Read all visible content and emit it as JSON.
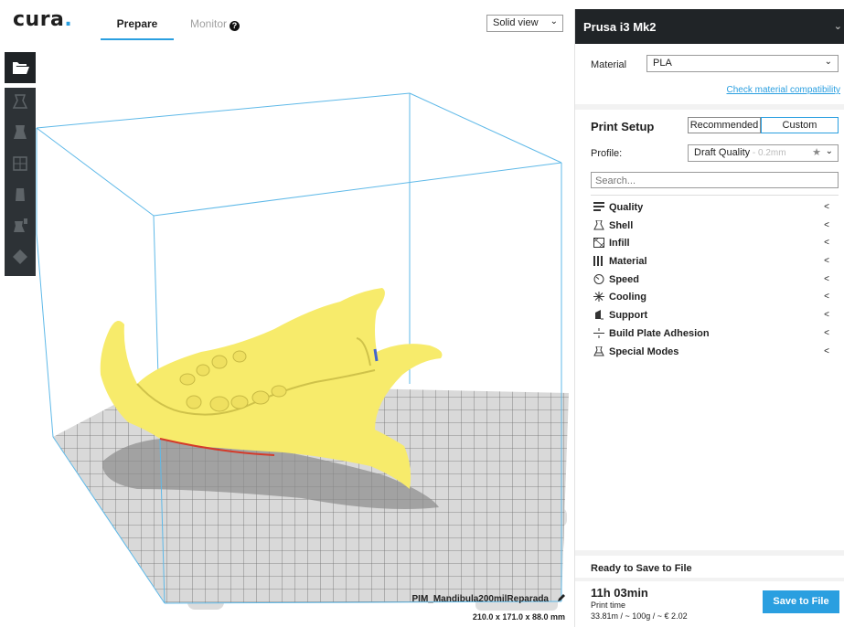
{
  "header": {
    "logo_text": "cura",
    "logo_dot": ".",
    "tabs": [
      {
        "label": "Prepare",
        "active": true
      },
      {
        "label": "Monitor",
        "active": false
      }
    ],
    "view_mode": "Solid view"
  },
  "toolbar": {
    "icons": [
      "open-file-icon",
      "move-tool-icon",
      "scale-tool-icon",
      "rotate-tool-icon",
      "mirror-tool-icon",
      "per-model-settings-icon",
      "support-blocker-icon"
    ]
  },
  "panel": {
    "machine_name": "Prusa i3 Mk2",
    "material_label": "Material",
    "material_value": "PLA",
    "compat_link": "Check material compatibility",
    "setup_title": "Print Setup",
    "mode_recommended": "Recommended",
    "mode_custom": "Custom",
    "profile_label": "Profile:",
    "profile_value": "Draft Quality",
    "profile_sub": " - 0.2mm",
    "search_placeholder": "Search...",
    "categories": [
      {
        "label": "Quality",
        "icon": "quality-icon"
      },
      {
        "label": "Shell",
        "icon": "shell-icon"
      },
      {
        "label": "Infill",
        "icon": "infill-icon"
      },
      {
        "label": "Material",
        "icon": "material-icon"
      },
      {
        "label": "Speed",
        "icon": "speed-icon"
      },
      {
        "label": "Cooling",
        "icon": "cooling-icon"
      },
      {
        "label": "Support",
        "icon": "support-icon"
      },
      {
        "label": "Build Plate Adhesion",
        "icon": "adhesion-icon"
      },
      {
        "label": "Special Modes",
        "icon": "special-modes-icon"
      }
    ],
    "save_title": "Ready to Save to File",
    "print_time": "11h 03min",
    "print_time_label": "Print time",
    "print_stats": "33.81m / ~ 100g / ~ € 2.02",
    "save_button": "Save to File"
  },
  "model": {
    "file_name": "PIM_Mandibula200milReparada",
    "dimensions": "210.0 x 171.0 x 88.0 mm"
  },
  "colors": {
    "accent": "#2a9fe0",
    "model": "#f7eb6b",
    "dark": "#202427",
    "volume_lines": "#5fb9e8"
  }
}
